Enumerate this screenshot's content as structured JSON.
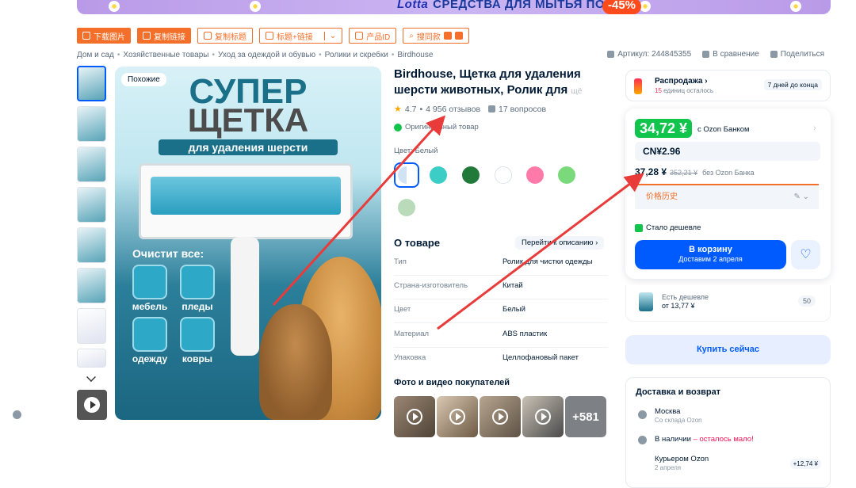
{
  "banner": {
    "brand": "Lotta",
    "text": "СРЕДСТВА ДЛЯ МЫТЬЯ ПОЛОВ",
    "discount": "-45%"
  },
  "toolbar": [
    {
      "label": "下载图片",
      "style": "solid"
    },
    {
      "label": "复制链接",
      "style": "solid"
    },
    {
      "label": "复制标题",
      "style": "outline"
    },
    {
      "label": "标题+链接",
      "style": "outline"
    },
    {
      "label": "产品ID",
      "style": "outline"
    },
    {
      "label": "搜同款",
      "style": "outline"
    }
  ],
  "breadcrumbs": [
    "Дом и сад",
    "Хозяйственные товары",
    "Уход за одеждой и обувью",
    "Ролики и скребки",
    "Birdhouse"
  ],
  "top_actions": {
    "sku": "Артикул: 244845355",
    "compare": "В сравнение",
    "share": "Поделиться"
  },
  "image": {
    "similar_badge": "Похожие",
    "headline_1": "СУПЕР",
    "headline_2": "ЩЕТКА",
    "subline": "для удаления шерсти",
    "cleans": "Очистит все:",
    "cats": [
      "мебель",
      "пледы",
      "одежду",
      "ковры"
    ]
  },
  "product": {
    "title": "Birdhouse, Щетка для удаления шерсти животных, Ролик для",
    "title_fade": "щё",
    "rating": "4.7",
    "reviews": "4 956 отзывов",
    "questions": "17 вопросов",
    "original": "Оригинальный товар",
    "color_label": "Цвет: Белый",
    "swatches": [
      "#dfeefa",
      "#3ccdc6",
      "#217a3a",
      "#ffffff",
      "#ff7aa8",
      "#7ad97a",
      "#b9dbb9"
    ]
  },
  "about": {
    "title": "О товаре",
    "goto": "Перейти к описанию",
    "specs": [
      {
        "k": "Тип",
        "v": "Ролик для чистки одежды"
      },
      {
        "k": "Страна-изготовитель",
        "v": "Китай"
      },
      {
        "k": "Цвет",
        "v": "Белый"
      },
      {
        "k": "Материал",
        "v": "ABS пластик"
      },
      {
        "k": "Упаковка",
        "v": "Целлофановый пакет"
      }
    ]
  },
  "photos": {
    "title": "Фото и видео покупателей",
    "more": "+581"
  },
  "sale": {
    "title": "Распродажа",
    "left_count": "15",
    "left_text": "единиц осталось",
    "days": "7 дней до конца"
  },
  "price": {
    "ozon_card": "34,72 ¥",
    "ozon_card_label": "с Ozon Банком",
    "cny": "CN¥2.96",
    "regular": "37,28 ¥",
    "old": "352,21 ¥",
    "regular_label": "без Ozon Банка",
    "history": "价格历史",
    "cheaper": "Стало дешевле",
    "cart": "В корзину",
    "delivery_date": "Доставим 2 апреля"
  },
  "cheaper_offer": {
    "title": "Есть дешевле",
    "price": "от 13,77 ¥",
    "count": "50"
  },
  "buy_now": "Купить сейчас",
  "delivery": {
    "title": "Доставка и возврат",
    "city": "Москва",
    "city_sub": "Со склада Ozon",
    "stock": "В наличии",
    "stock_warn": "– осталось мало!",
    "courier": "Курьером Ozon",
    "courier_date": "2 апреля",
    "courier_price": "+12,74 ¥"
  },
  "colors": {
    "ozon_blue": "#005bff",
    "green": "#10c44c",
    "orange": "#f36f2a",
    "arrow_red": "#ea3b3b"
  }
}
